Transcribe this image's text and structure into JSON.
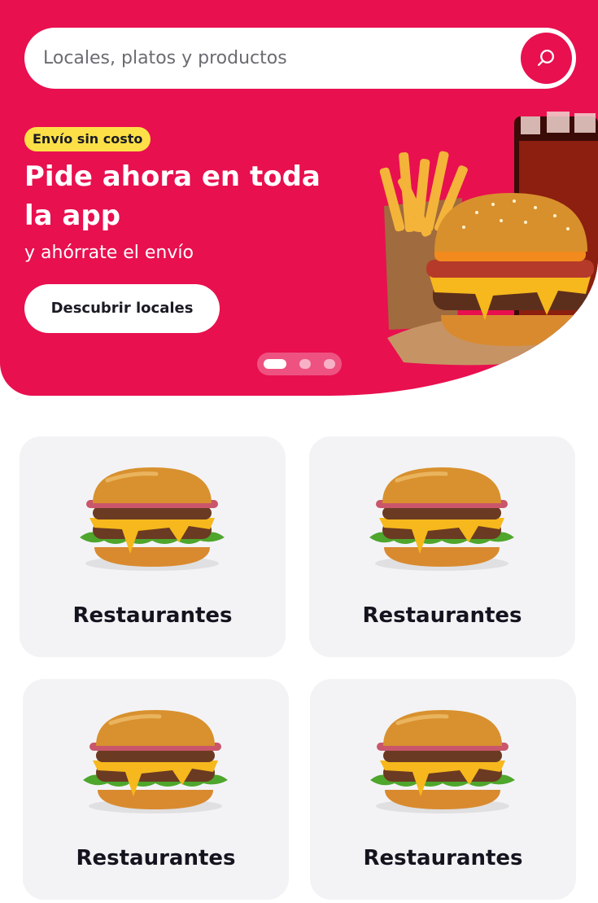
{
  "search": {
    "placeholder": "Locales, platos y productos",
    "icon": "search-icon"
  },
  "banner": {
    "badge": "Envío sin costo",
    "title": "Pide ahora en toda la app",
    "subtitle": "y ahórrate el envío",
    "cta_label": "Descubrir locales",
    "carousel": {
      "slides": 3,
      "active_index": 0
    },
    "image": "burger-fries-soda-image"
  },
  "categories": [
    {
      "label": "Restaurantes",
      "icon": "burger-image"
    },
    {
      "label": "Restaurantes",
      "icon": "burger-image"
    },
    {
      "label": "Restaurantes",
      "icon": "burger-image"
    },
    {
      "label": "Restaurantes",
      "icon": "burger-image"
    }
  ],
  "colors": {
    "brand": "#e8104f",
    "badge": "#fde047",
    "card_background": "#f3f3f6",
    "text_dark": "#14141f"
  }
}
